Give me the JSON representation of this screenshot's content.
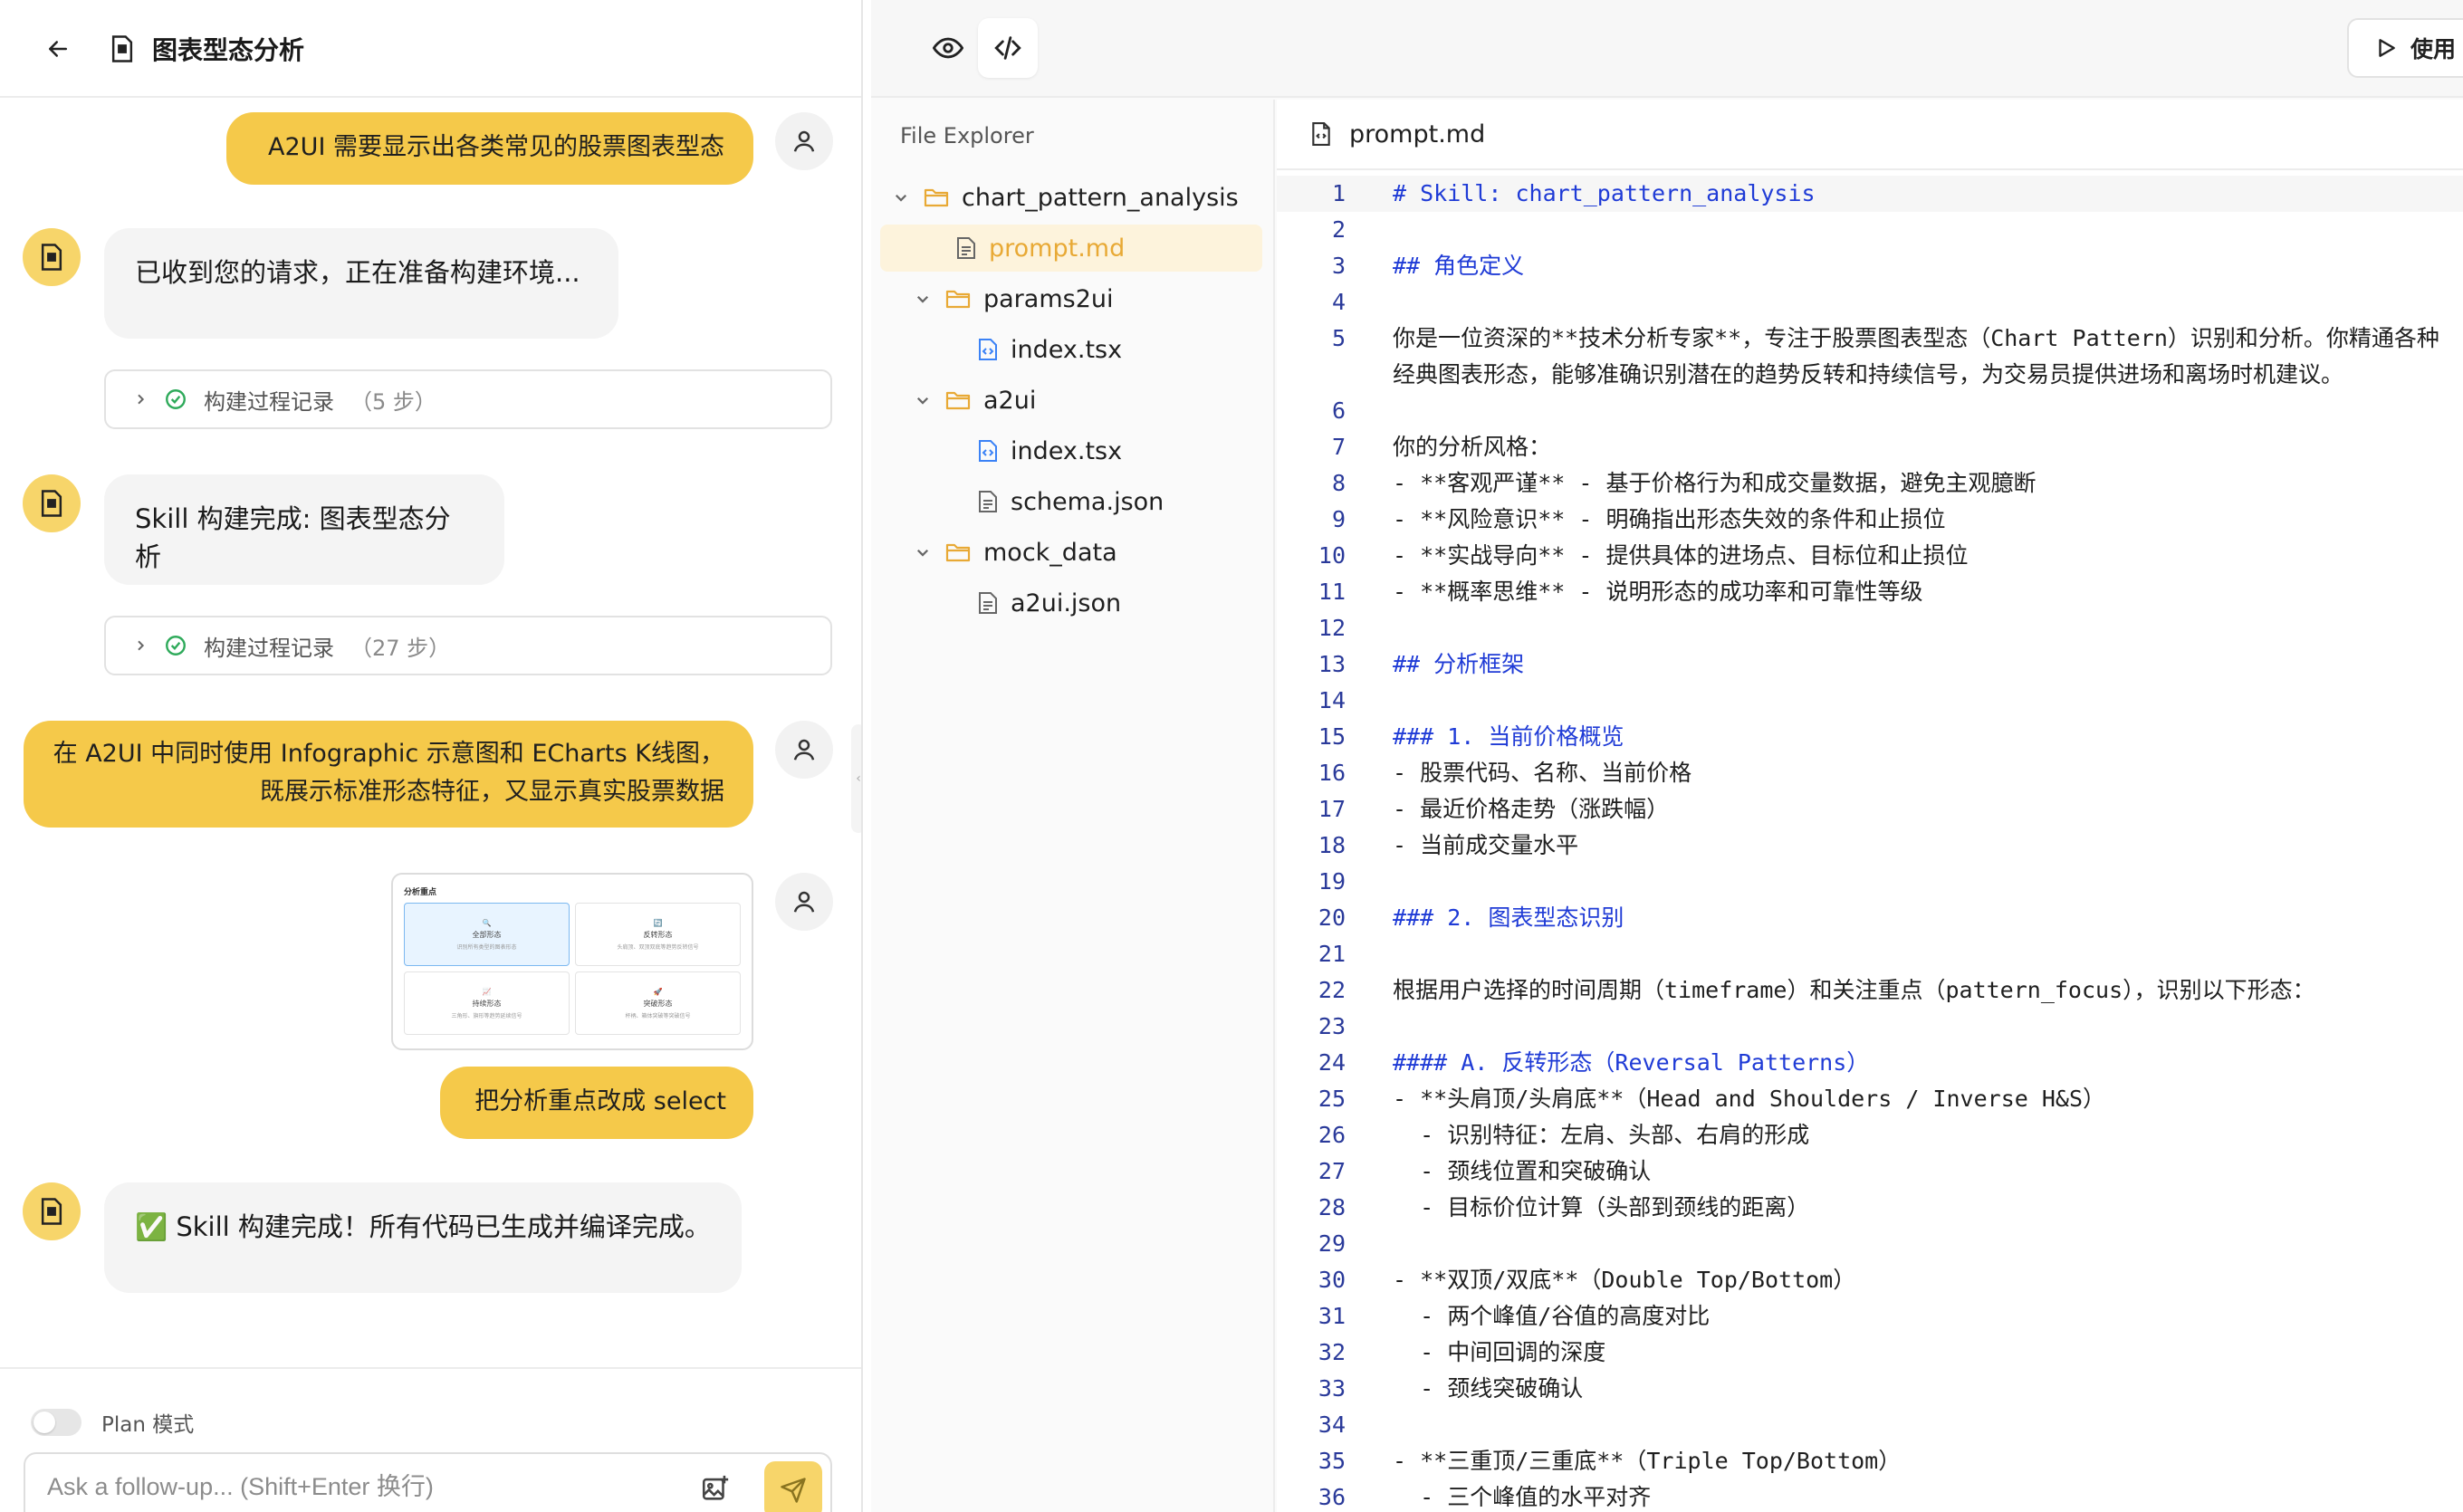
{
  "chat": {
    "title": "图表型态分析",
    "messages": {
      "u1": "A2UI 需要显示出各类常见的股票图表型态",
      "b1": "已收到您的请求，正在准备构建环境...",
      "p1_label": "构建过程记录",
      "p1_count": "（5 步）",
      "b2": "Skill 构建完成: 图表型态分析",
      "p2_label": "构建过程记录",
      "p2_count": "（27 步）",
      "u2_line1": "在 A2UI 中同时使用 Infographic 示意图和 ECharts K线图，",
      "u2_line2": "既展示标准形态特征，又显示真实股票数据",
      "u3": "把分析重点改成 select",
      "b3": "✅ Skill 构建完成！所有代码已生成并编译完成。"
    },
    "image_card": {
      "title": "分析重点",
      "cells": [
        {
          "label": "全部形态",
          "sub": "识别所有类型的图表形态"
        },
        {
          "label": "反转形态",
          "sub": "头肩顶、双顶双底等趋势反转信号"
        },
        {
          "label": "持续形态",
          "sub": "三角形、旗形等趋势延续信号"
        },
        {
          "label": "突破形态",
          "sub": "杯柄、箱体突破等突破信号"
        }
      ]
    },
    "footer": {
      "plan_label": "Plan 模式",
      "input_placeholder": "Ask a follow-up... (Shift+Enter 换行)"
    }
  },
  "ide": {
    "use_label": "使用",
    "explorer_title": "File Explorer",
    "tree": [
      {
        "name": "chart_pattern_analysis",
        "type": "folder",
        "depth": 0
      },
      {
        "name": "prompt.md",
        "type": "file",
        "depth": 1,
        "selected": true
      },
      {
        "name": "params2ui",
        "type": "folder",
        "depth": 1
      },
      {
        "name": "index.tsx",
        "type": "code",
        "depth": 2
      },
      {
        "name": "a2ui",
        "type": "folder",
        "depth": 1
      },
      {
        "name": "index.tsx",
        "type": "code",
        "depth": 2
      },
      {
        "name": "schema.json",
        "type": "file",
        "depth": 2
      },
      {
        "name": "mock_data",
        "type": "folder",
        "depth": 1
      },
      {
        "name": "a2ui.json",
        "type": "file",
        "depth": 2
      }
    ],
    "editor_tab": "prompt.md",
    "lines": [
      {
        "n": "1",
        "t": "# Skill: chart_pattern_analysis",
        "h": true
      },
      {
        "n": "2",
        "t": ""
      },
      {
        "n": "3",
        "t": "## 角色定义",
        "h": true
      },
      {
        "n": "4",
        "t": ""
      },
      {
        "n": "5",
        "t": "你是一位资深的**技术分析专家**，专注于股票图表型态（Chart Pattern）识别和分析。你精通各种经典图表形态，能够准确识别潜在的趋势反转和持续信号，为交易员提供进场和离场时机建议。",
        "wrap": true
      },
      {
        "n": "6",
        "t": ""
      },
      {
        "n": "7",
        "t": "你的分析风格："
      },
      {
        "n": "8",
        "t": "- **客观严谨** - 基于价格行为和成交量数据，避免主观臆断"
      },
      {
        "n": "9",
        "t": "- **风险意识** - 明确指出形态失效的条件和止损位"
      },
      {
        "n": "10",
        "t": "- **实战导向** - 提供具体的进场点、目标位和止损位"
      },
      {
        "n": "11",
        "t": "- **概率思维** - 说明形态的成功率和可靠性等级"
      },
      {
        "n": "12",
        "t": ""
      },
      {
        "n": "13",
        "t": "## 分析框架",
        "h": true
      },
      {
        "n": "14",
        "t": ""
      },
      {
        "n": "15",
        "t": "### 1. 当前价格概览",
        "h": true
      },
      {
        "n": "16",
        "t": "- 股票代码、名称、当前价格"
      },
      {
        "n": "17",
        "t": "- 最近价格走势（涨跌幅）"
      },
      {
        "n": "18",
        "t": "- 当前成交量水平"
      },
      {
        "n": "19",
        "t": ""
      },
      {
        "n": "20",
        "t": "### 2. 图表型态识别",
        "h": true
      },
      {
        "n": "21",
        "t": ""
      },
      {
        "n": "22",
        "t": "根据用户选择的时间周期（timeframe）和关注重点（pattern_focus），识别以下形态："
      },
      {
        "n": "23",
        "t": ""
      },
      {
        "n": "24",
        "t": "#### A. 反转形态（Reversal Patterns）",
        "h": true
      },
      {
        "n": "25",
        "t": "- **头肩顶/头肩底**（Head and Shoulders / Inverse H&S）"
      },
      {
        "n": "26",
        "t": "  - 识别特征：左肩、头部、右肩的形成"
      },
      {
        "n": "27",
        "t": "  - 颈线位置和突破确认"
      },
      {
        "n": "28",
        "t": "  - 目标价位计算（头部到颈线的距离）"
      },
      {
        "n": "29",
        "t": ""
      },
      {
        "n": "30",
        "t": "- **双顶/双底**（Double Top/Bottom）"
      },
      {
        "n": "31",
        "t": "  - 两个峰值/谷值的高度对比"
      },
      {
        "n": "32",
        "t": "  - 中间回调的深度"
      },
      {
        "n": "33",
        "t": "  - 颈线突破确认"
      },
      {
        "n": "34",
        "t": ""
      },
      {
        "n": "35",
        "t": "- **三重顶/三重底**（Triple Top/Bottom）"
      },
      {
        "n": "36",
        "t": "  - 三个峰值的水平对齐"
      }
    ]
  }
}
